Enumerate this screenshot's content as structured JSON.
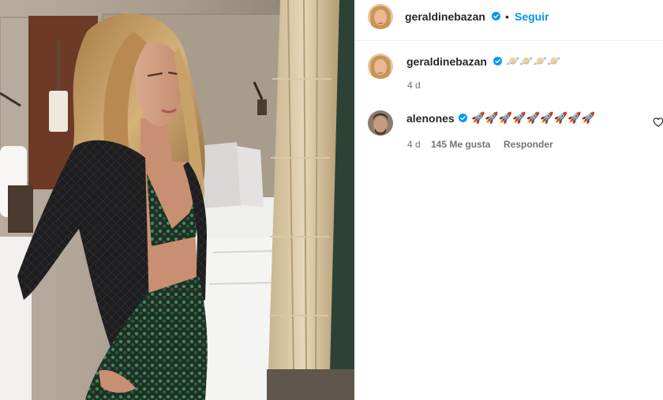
{
  "header": {
    "username": "geraldinebazan",
    "separator": "•",
    "follow_label": "Seguir",
    "avatar_icon": "profile-avatar",
    "verified_icon": "verified-badge-icon"
  },
  "caption": {
    "username": "geraldinebazan",
    "text": "🪐🪐🪐🪐",
    "age": "4 d"
  },
  "comments": [
    {
      "username": "alenones",
      "text": "🚀🚀🚀🚀🚀🚀🚀🚀🚀",
      "age": "4 d",
      "likes": "145 Me gusta",
      "reply_label": "Responder",
      "like_icon": "heart-icon"
    }
  ],
  "colors": {
    "accent": "#0095f6",
    "verified": "#0095f6",
    "text": "#262626",
    "secondary": "#737373"
  }
}
